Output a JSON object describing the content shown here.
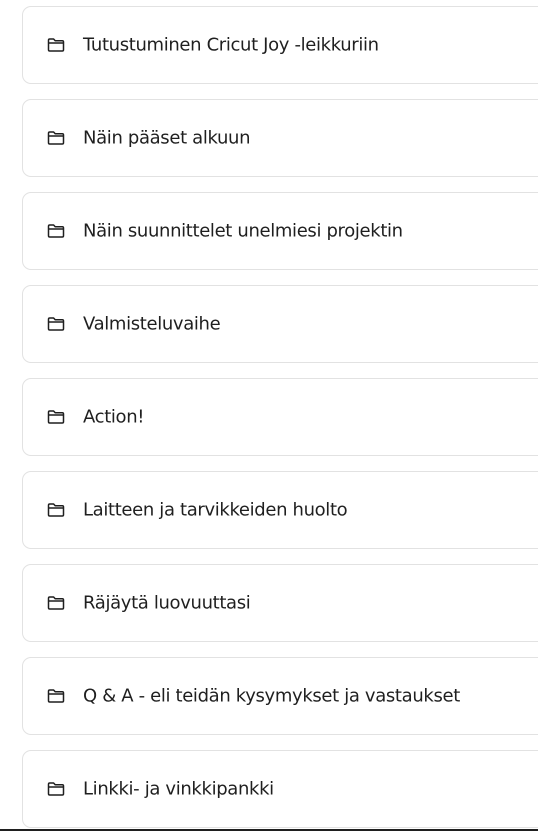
{
  "course_sections": [
    {
      "label": "Tutustuminen Cricut Joy -leikkuriin",
      "icon": "folder-icon"
    },
    {
      "label": "Näin pääset alkuun",
      "icon": "folder-icon"
    },
    {
      "label": "Näin suunnittelet unelmiesi projektin",
      "icon": "folder-icon"
    },
    {
      "label": "Valmisteluvaihe",
      "icon": "folder-icon"
    },
    {
      "label": "Action!",
      "icon": "folder-icon"
    },
    {
      "label": "Laitteen ja tarvikkeiden huolto",
      "icon": "folder-icon"
    },
    {
      "label": "Räjäytä luovuuttasi",
      "icon": "folder-icon"
    },
    {
      "label": "Q & A - eli teidän kysymykset ja vastaukset",
      "icon": "folder-icon"
    },
    {
      "label": "Linkki- ja vinkkipankki",
      "icon": "folder-icon"
    }
  ]
}
